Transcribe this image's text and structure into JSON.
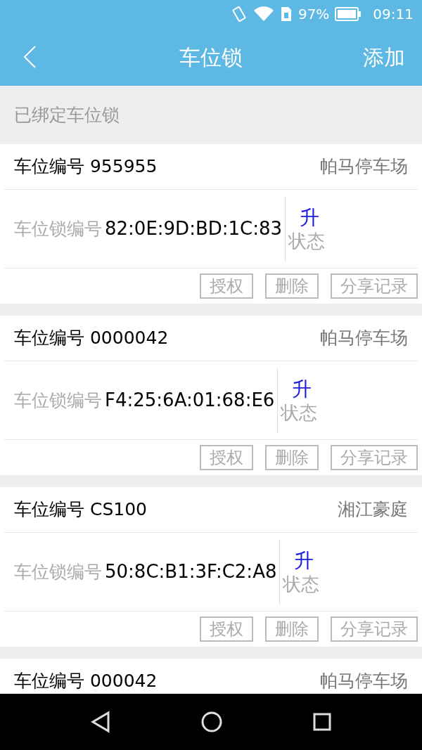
{
  "status_bar": {
    "battery": "97%",
    "time": "09:11"
  },
  "header": {
    "title": "车位锁",
    "action": "添加"
  },
  "section_title": "已绑定车位锁",
  "cards": [
    {
      "title": "车位编号 955955",
      "lot": "帕马停车场",
      "lock_label": "车位锁编号",
      "lock_id": "82:0E:9D:BD:1C:83",
      "state": "升",
      "state_label": "状态",
      "buttons": [
        "授权",
        "删除",
        "分享记录"
      ]
    },
    {
      "title": "车位编号 0000042",
      "lot": "帕马停车场",
      "lock_label": "车位锁编号",
      "lock_id": "F4:25:6A:01:68:E6",
      "state": "升",
      "state_label": "状态",
      "buttons": [
        "授权",
        "删除",
        "分享记录"
      ]
    },
    {
      "title": "车位编号 CS100",
      "lot": "湘江豪庭",
      "lock_label": "车位锁编号",
      "lock_id": "50:8C:B1:3F:C2:A8",
      "state": "升",
      "state_label": "状态",
      "buttons": [
        "授权",
        "删除",
        "分享记录"
      ]
    },
    {
      "title": "车位编号 000042",
      "lot": "帕马停车场"
    }
  ]
}
